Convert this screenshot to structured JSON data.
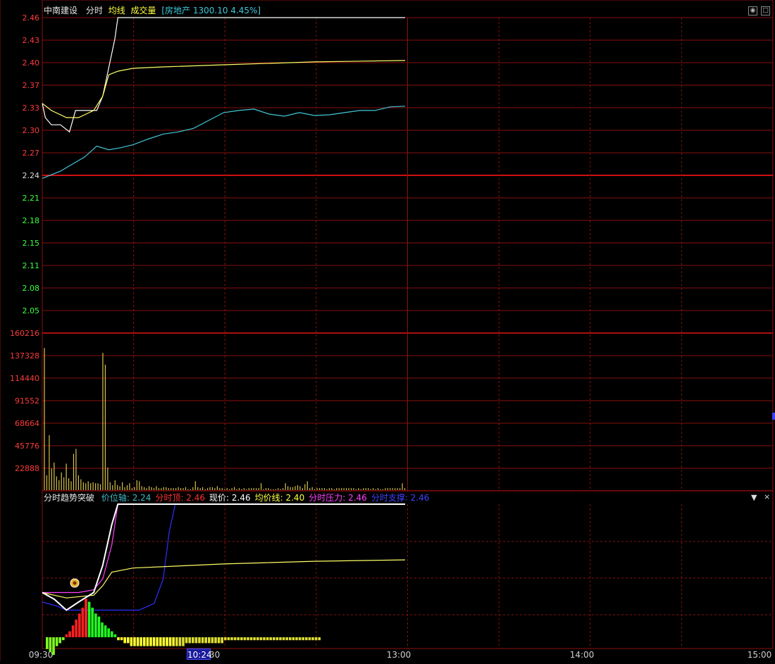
{
  "header": {
    "stock_name": "中南建设",
    "tab_fenshi": "分时",
    "tab_junxian": "均线",
    "tab_volume": "成交量",
    "sector_text": "[房地产 1300.10 4.45%]"
  },
  "indicator_header": {
    "name": "分时趋势突破",
    "items": [
      {
        "label": "价位轴:",
        "value": "2.24",
        "color": "#3fb7c4"
      },
      {
        "label": "分时顶:",
        "value": "2.46",
        "color": "#ff3030"
      },
      {
        "label": "现价:",
        "value": "2.46",
        "color": "#ffffff"
      },
      {
        "label": "均价线:",
        "value": "2.40",
        "color": "#ffff40"
      },
      {
        "label": "分时压力:",
        "value": "2.46",
        "color": "#ff40ff"
      },
      {
        "label": "分时支撑:",
        "value": "2.46",
        "color": "#4040ff"
      }
    ]
  },
  "cursor_time": "10:24",
  "colors": {
    "grid": "#8a1010",
    "price_up": "#ff3b3b",
    "price_down": "#3bff3b",
    "price_line": "#ffffff",
    "avg_line": "#ffff66",
    "sector_line": "#3fc8d8",
    "volume": "#d8c24a"
  },
  "chart_data": {
    "type": "line",
    "title": "中南建设 分时",
    "x_ticks": [
      "09:30",
      "10:30",
      "13:00",
      "14:00",
      "15:00"
    ],
    "price_axis": {
      "ticks": [
        "2.46",
        "2.43",
        "2.40",
        "2.37",
        "2.33",
        "2.30",
        "2.27",
        "2.24",
        "2.21",
        "2.18",
        "2.15",
        "2.11",
        "2.08",
        "2.05"
      ],
      "prev_close": 2.24,
      "ylim": [
        2.02,
        2.46
      ]
    },
    "volume_axis": {
      "ticks": [
        "160216",
        "137328",
        "114440",
        "91552",
        "68664",
        "45776",
        "22888"
      ],
      "ylim": [
        0,
        160216
      ]
    },
    "series": [
      {
        "name": "分时",
        "color": "#ffffff",
        "points": [
          [
            0,
            2.34
          ],
          [
            1,
            2.32
          ],
          [
            3,
            2.31
          ],
          [
            6,
            2.31
          ],
          [
            9,
            2.3
          ],
          [
            11,
            2.33
          ],
          [
            14,
            2.33
          ],
          [
            18,
            2.33
          ],
          [
            20,
            2.35
          ],
          [
            22,
            2.39
          ],
          [
            23,
            2.41
          ],
          [
            24,
            2.43
          ],
          [
            25,
            2.46
          ],
          [
            120,
            2.46
          ]
        ]
      },
      {
        "name": "均线",
        "color": "#ffff66",
        "points": [
          [
            0,
            2.34
          ],
          [
            3,
            2.33
          ],
          [
            8,
            2.32
          ],
          [
            12,
            2.32
          ],
          [
            17,
            2.33
          ],
          [
            20,
            2.35
          ],
          [
            22,
            2.38
          ],
          [
            25,
            2.385
          ],
          [
            30,
            2.389
          ],
          [
            40,
            2.391
          ],
          [
            60,
            2.394
          ],
          [
            90,
            2.398
          ],
          [
            120,
            2.4
          ]
        ]
      },
      {
        "name": "房地产",
        "color": "#3fc8d8",
        "points": [
          [
            0,
            2.235
          ],
          [
            3,
            2.24
          ],
          [
            6,
            2.245
          ],
          [
            10,
            2.255
          ],
          [
            14,
            2.265
          ],
          [
            18,
            2.28
          ],
          [
            22,
            2.275
          ],
          [
            26,
            2.278
          ],
          [
            30,
            2.282
          ],
          [
            35,
            2.29
          ],
          [
            40,
            2.297
          ],
          [
            45,
            2.3
          ],
          [
            50,
            2.305
          ],
          [
            55,
            2.316
          ],
          [
            60,
            2.327
          ],
          [
            65,
            2.33
          ],
          [
            70,
            2.332
          ],
          [
            75,
            2.325
          ],
          [
            80,
            2.322
          ],
          [
            85,
            2.327
          ],
          [
            90,
            2.323
          ],
          [
            95,
            2.324
          ],
          [
            100,
            2.327
          ],
          [
            105,
            2.33
          ],
          [
            110,
            2.33
          ],
          [
            115,
            2.335
          ],
          [
            120,
            2.336
          ]
        ]
      }
    ],
    "volume": [
      145000,
      15000,
      56000,
      22000,
      28000,
      14000,
      10000,
      18000,
      13000,
      27000,
      12000,
      9000,
      37000,
      42000,
      15000,
      11000,
      8000,
      7000,
      9000,
      7000,
      8000,
      7000,
      7000,
      6000,
      140000,
      128000,
      23000,
      8000,
      5000,
      10000,
      5000,
      4000,
      8000,
      3000,
      5000,
      7000,
      2000,
      3000,
      10000,
      9000,
      4000,
      3000,
      2000,
      4000,
      3000,
      2000,
      4000,
      2000,
      2000,
      3000,
      3000,
      2000,
      2000,
      2000,
      2000,
      3000,
      2000,
      2000,
      3000,
      1000,
      1000,
      3000,
      9000,
      3000,
      2000,
      3000,
      1000,
      2000,
      3000,
      3000,
      2000,
      4000,
      2000,
      2000,
      1000,
      2000,
      1000,
      2000,
      3000,
      1000,
      2000,
      1000,
      2000,
      1000,
      2000,
      2000,
      2000,
      2000,
      2000,
      7000,
      1000,
      2000,
      2000,
      1000,
      1000,
      1000,
      2000,
      1000,
      2000,
      7000,
      4000,
      3000,
      3000,
      4000,
      5000,
      4000,
      2000,
      6000,
      9000,
      2000,
      3000,
      1000,
      2000,
      2000,
      2000,
      2000,
      1000,
      2000,
      2000,
      1000,
      2000,
      2000,
      2000,
      2000,
      2000,
      2000,
      2000,
      2000,
      1000,
      2000,
      1000,
      2000,
      2000,
      2000,
      1000,
      2000,
      1000,
      2000,
      1000,
      1000,
      2000,
      2000,
      2000,
      2000,
      2000,
      2000,
      2000,
      7000,
      2000
    ],
    "indicator": {
      "price_line": [
        [
          0,
          0.35
        ],
        [
          4,
          0.3
        ],
        [
          8,
          0.22
        ],
        [
          12,
          0.28
        ],
        [
          17,
          0.35
        ],
        [
          20,
          0.55
        ],
        [
          23,
          0.85
        ],
        [
          25,
          1.0
        ],
        [
          120,
          1.0
        ]
      ],
      "avg_line": [
        [
          0,
          0.35
        ],
        [
          8,
          0.31
        ],
        [
          17,
          0.33
        ],
        [
          20,
          0.4
        ],
        [
          23,
          0.5
        ],
        [
          30,
          0.53
        ],
        [
          60,
          0.56
        ],
        [
          90,
          0.58
        ],
        [
          120,
          0.59
        ]
      ],
      "pressure_line": [
        [
          0,
          0.35
        ],
        [
          12,
          0.35
        ],
        [
          17,
          0.37
        ],
        [
          20,
          0.45
        ],
        [
          23,
          0.7
        ],
        [
          25,
          1.0
        ],
        [
          120,
          1.0
        ]
      ],
      "support_line": [
        [
          0,
          0.28
        ],
        [
          5,
          0.25
        ],
        [
          8,
          0.22
        ],
        [
          32,
          0.22
        ],
        [
          37,
          0.27
        ],
        [
          40,
          0.45
        ],
        [
          42,
          0.8
        ],
        [
          44,
          1.0
        ],
        [
          120,
          1.0
        ]
      ],
      "histogram": [
        -4,
        -5,
        -6,
        -3,
        -2,
        -1,
        1,
        2,
        4,
        6,
        8,
        10,
        13,
        12,
        10,
        8,
        7,
        5,
        4,
        3,
        2,
        1,
        -1,
        -1,
        -2,
        -2,
        -3,
        -3,
        -3,
        -3,
        -3,
        -3,
        -3,
        -3,
        -3,
        -3,
        -3,
        -3,
        -3,
        -3,
        -3,
        -3,
        -3,
        -2,
        -2,
        -2,
        -2,
        -2,
        -2,
        -2,
        -2,
        -2,
        -2,
        -2,
        -2,
        -1,
        -1,
        -1,
        -1,
        -1,
        -1,
        -1,
        -1,
        -1,
        -1,
        -1,
        -1,
        -1,
        -1,
        -1,
        -1,
        -1,
        -1,
        -1,
        -1,
        -1,
        -1,
        -1,
        -1,
        -1,
        -1,
        -1,
        -1,
        -1,
        -1
      ]
    },
    "xlabel": "",
    "ylabel": ""
  }
}
